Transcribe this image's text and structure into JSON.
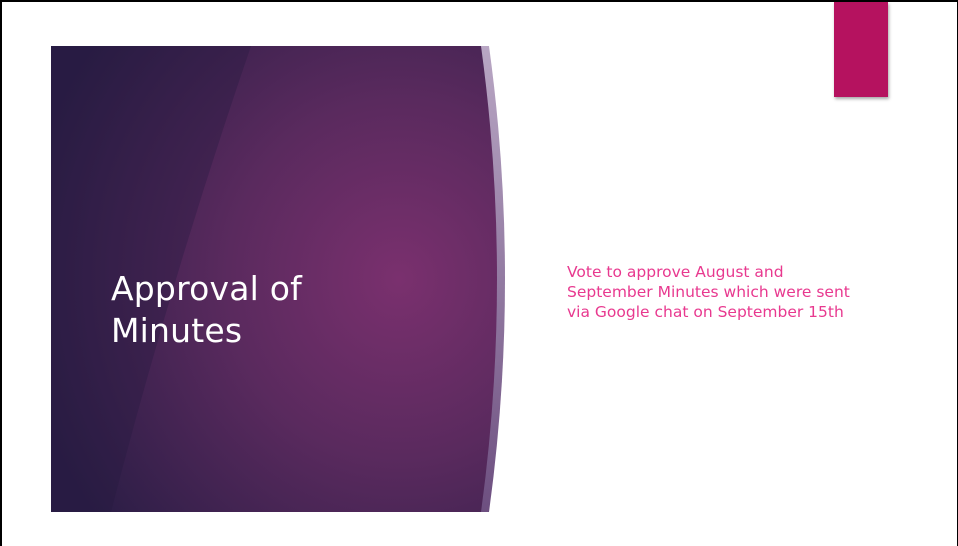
{
  "slide": {
    "title": "Approval of Minutes",
    "body": "Vote to approve August and September Minutes which were sent via Google chat on September 15th"
  },
  "colors": {
    "accent": "#b5125f",
    "panel_dark": "#2e1f4a",
    "panel_light": "#7b3170",
    "body_text": "#e8398f",
    "title_text": "#ffffff"
  }
}
